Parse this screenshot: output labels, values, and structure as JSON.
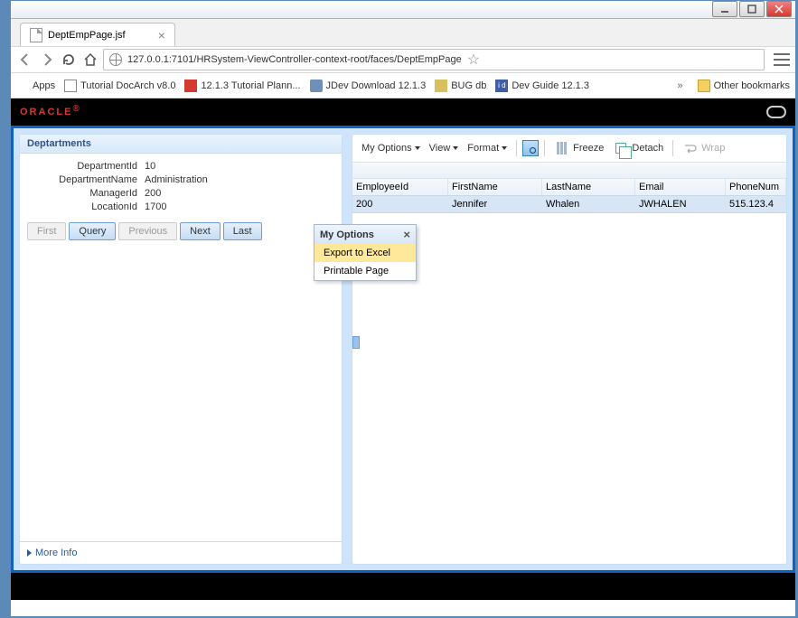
{
  "browser": {
    "tab_title": "DeptEmpPage.jsf",
    "url": "127.0.0.1:7101/HRSystem-ViewController-context-root/faces/DeptEmpPage",
    "bookmarks": {
      "apps": "Apps",
      "b1": "Tutorial DocArch v8.0",
      "b2": "12.1.3 Tutorial Plann...",
      "b3": "JDev Download 12.1.3",
      "b4": "BUG db",
      "b5": "Dev Guide 12.1.3",
      "other": "Other bookmarks"
    }
  },
  "brand": "ORACLE",
  "left_panel": {
    "title": "Deptartments",
    "fields": {
      "dept_id": {
        "label": "DepartmentId",
        "value": "10"
      },
      "dept_name": {
        "label": "DepartmentName",
        "value": "Administration"
      },
      "manager_id": {
        "label": "ManagerId",
        "value": "200"
      },
      "location_id": {
        "label": "LocationId",
        "value": "1700"
      }
    },
    "buttons": {
      "first": "First",
      "query": "Query",
      "prev": "Previous",
      "next": "Next",
      "last": "Last"
    },
    "more": "More Info"
  },
  "right_panel": {
    "toolbar": {
      "my_options": "My Options",
      "view": "View",
      "format": "Format",
      "freeze": "Freeze",
      "detach": "Detach",
      "wrap": "Wrap"
    },
    "columns": {
      "eid": "EmployeeId",
      "fn": "FirstName",
      "ln": "LastName",
      "em": "Email",
      "ph": "PhoneNum"
    },
    "rows": [
      {
        "eid": "200",
        "fn": "Jennifer",
        "ln": "Whalen",
        "em": "JWHALEN",
        "ph": "515.123.4"
      }
    ]
  },
  "popup": {
    "title": "My Options",
    "item1": "Export to Excel",
    "item2": "Printable Page"
  }
}
